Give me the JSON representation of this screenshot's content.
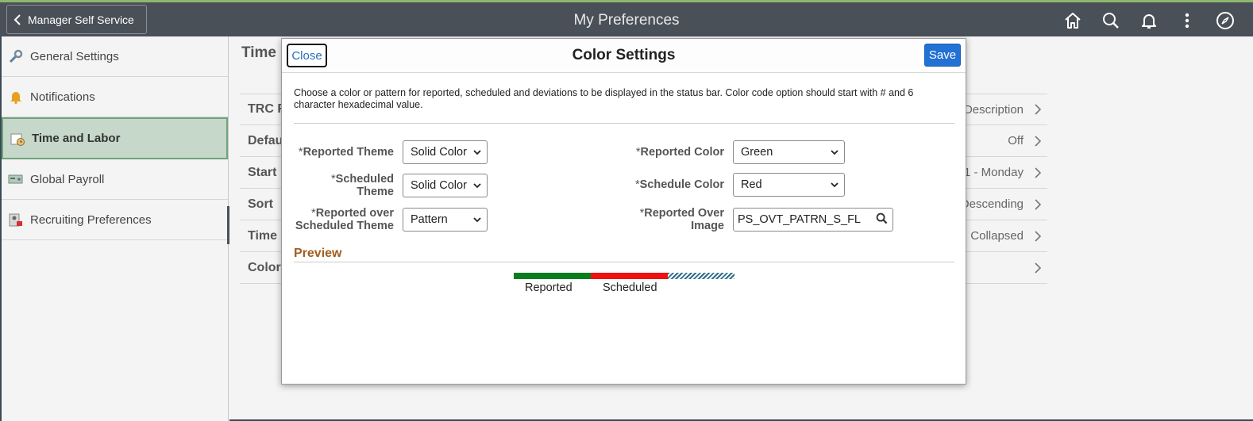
{
  "header": {
    "back_label": "Manager Self Service",
    "title": "My Preferences",
    "icons": [
      "home-icon",
      "search-icon",
      "bell-icon",
      "more-vertical-icon",
      "compass-icon"
    ]
  },
  "sidebar": {
    "items": [
      {
        "label": "General Settings",
        "icon": "wrench-icon"
      },
      {
        "label": "Notifications",
        "icon": "bell-icon"
      },
      {
        "label": "Time and Labor",
        "icon": "clock-calendar-icon",
        "active": true
      },
      {
        "label": "Global Payroll",
        "icon": "payroll-icon"
      },
      {
        "label": "Recruiting Preferences",
        "icon": "recruiting-icon"
      }
    ]
  },
  "main": {
    "title": "Time",
    "rows": [
      {
        "label": "TRC R",
        "value": "Description"
      },
      {
        "label": "Defau",
        "value": "Off"
      },
      {
        "label": "Start",
        "value": "1 - Monday"
      },
      {
        "label": "Sort",
        "value": "Descending"
      },
      {
        "label": "Time",
        "value": "Collapsed"
      },
      {
        "label": "Color",
        "value": ""
      }
    ]
  },
  "modal": {
    "close_label": "Close",
    "title": "Color Settings",
    "save_label": "Save",
    "intro": "Choose a color or pattern for reported, scheduled and deviations to be displayed in the status bar. Color code option should start with # and 6 character hexadecimal value.",
    "fields": {
      "reported_theme": {
        "required": "*",
        "label": "Reported Theme",
        "value": "Solid Color"
      },
      "scheduled_theme": {
        "required": "*",
        "label_line1": "Scheduled",
        "label_line2": "Theme",
        "value": "Solid Color"
      },
      "reported_over_scheduled_theme": {
        "required": "*",
        "label_line1": "Reported over",
        "label_line2": "Scheduled Theme",
        "value": "Pattern"
      },
      "reported_color": {
        "required": "*",
        "label": "Reported Color",
        "value": "Green"
      },
      "schedule_color": {
        "required": "*",
        "label": "Schedule Color",
        "value": "Red"
      },
      "reported_over_image": {
        "required": "*",
        "label_line1": "Reported Over",
        "label_line2": "Image",
        "value": "PS_OVT_PATRN_S_FL"
      }
    },
    "preview": {
      "title": "Preview",
      "reported_label": "Reported",
      "scheduled_label": "Scheduled",
      "colors": {
        "reported": "#0a7d1e",
        "scheduled": "#ee1111",
        "pattern": "#2e6d8a"
      }
    }
  }
}
